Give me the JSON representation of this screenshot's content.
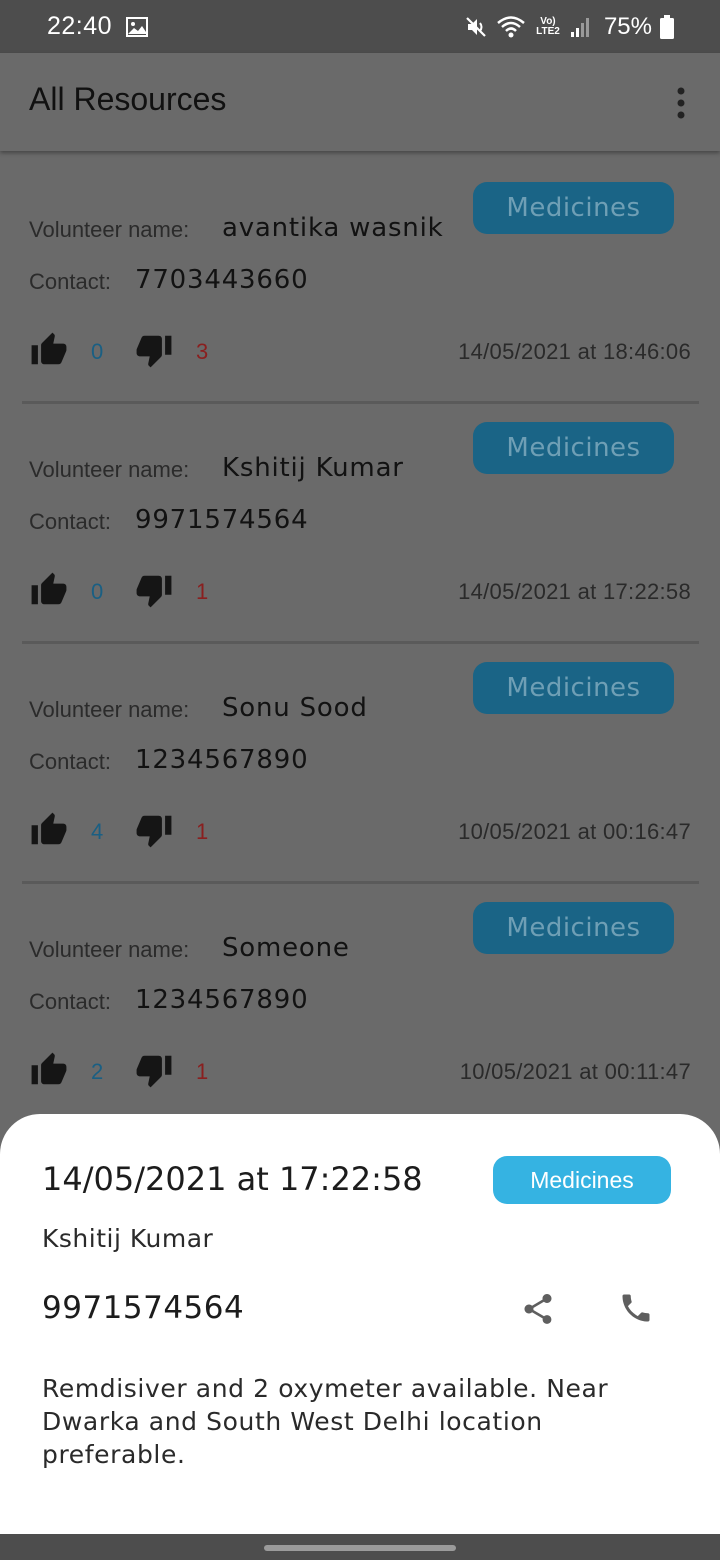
{
  "status_bar": {
    "time": "22:40",
    "battery": "75%",
    "network_label": "Vo) LTE2"
  },
  "app_bar": {
    "title": "All Resources"
  },
  "labels": {
    "volunteer": "Volunteer name:",
    "contact": "Contact:"
  },
  "cards": [
    {
      "category": "Medicines",
      "volunteer_name": "avantika wasnik",
      "contact": "7703443660",
      "upvotes": "0",
      "downvotes": "3",
      "date": "14/05/2021 at 18:46:06"
    },
    {
      "category": "Medicines",
      "volunteer_name": "Kshitij Kumar",
      "contact": "9971574564",
      "upvotes": "0",
      "downvotes": "1",
      "date": "14/05/2021 at 17:22:58"
    },
    {
      "category": "Medicines",
      "volunteer_name": "Sonu Sood",
      "contact": "1234567890",
      "upvotes": "4",
      "downvotes": "1",
      "date": "10/05/2021 at 00:16:47"
    },
    {
      "category": "Medicines",
      "volunteer_name": "Someone",
      "contact": "1234567890",
      "upvotes": "2",
      "downvotes": "1",
      "date": "10/05/2021 at 00:11:47"
    }
  ],
  "sheet": {
    "date": "14/05/2021 at 17:22:58",
    "category": "Medicines",
    "name": "Kshitij Kumar",
    "phone": "9971574564",
    "description": "Remdisiver and 2 oxymeter available. Near Dwarka and South West Delhi location preferable."
  },
  "colors": {
    "chip_dark": "#1a6486",
    "chip_light": "#35b3e2",
    "upvote": "#1a5f83",
    "downvote": "#8a1f1f",
    "scrim_bg": "#6a6a6a"
  },
  "icons": [
    "image-icon",
    "mute-icon",
    "wifi-icon",
    "signal-icon",
    "battery-icon",
    "more-vert-icon",
    "thumb-up-icon",
    "thumb-down-icon",
    "share-icon",
    "phone-icon"
  ]
}
